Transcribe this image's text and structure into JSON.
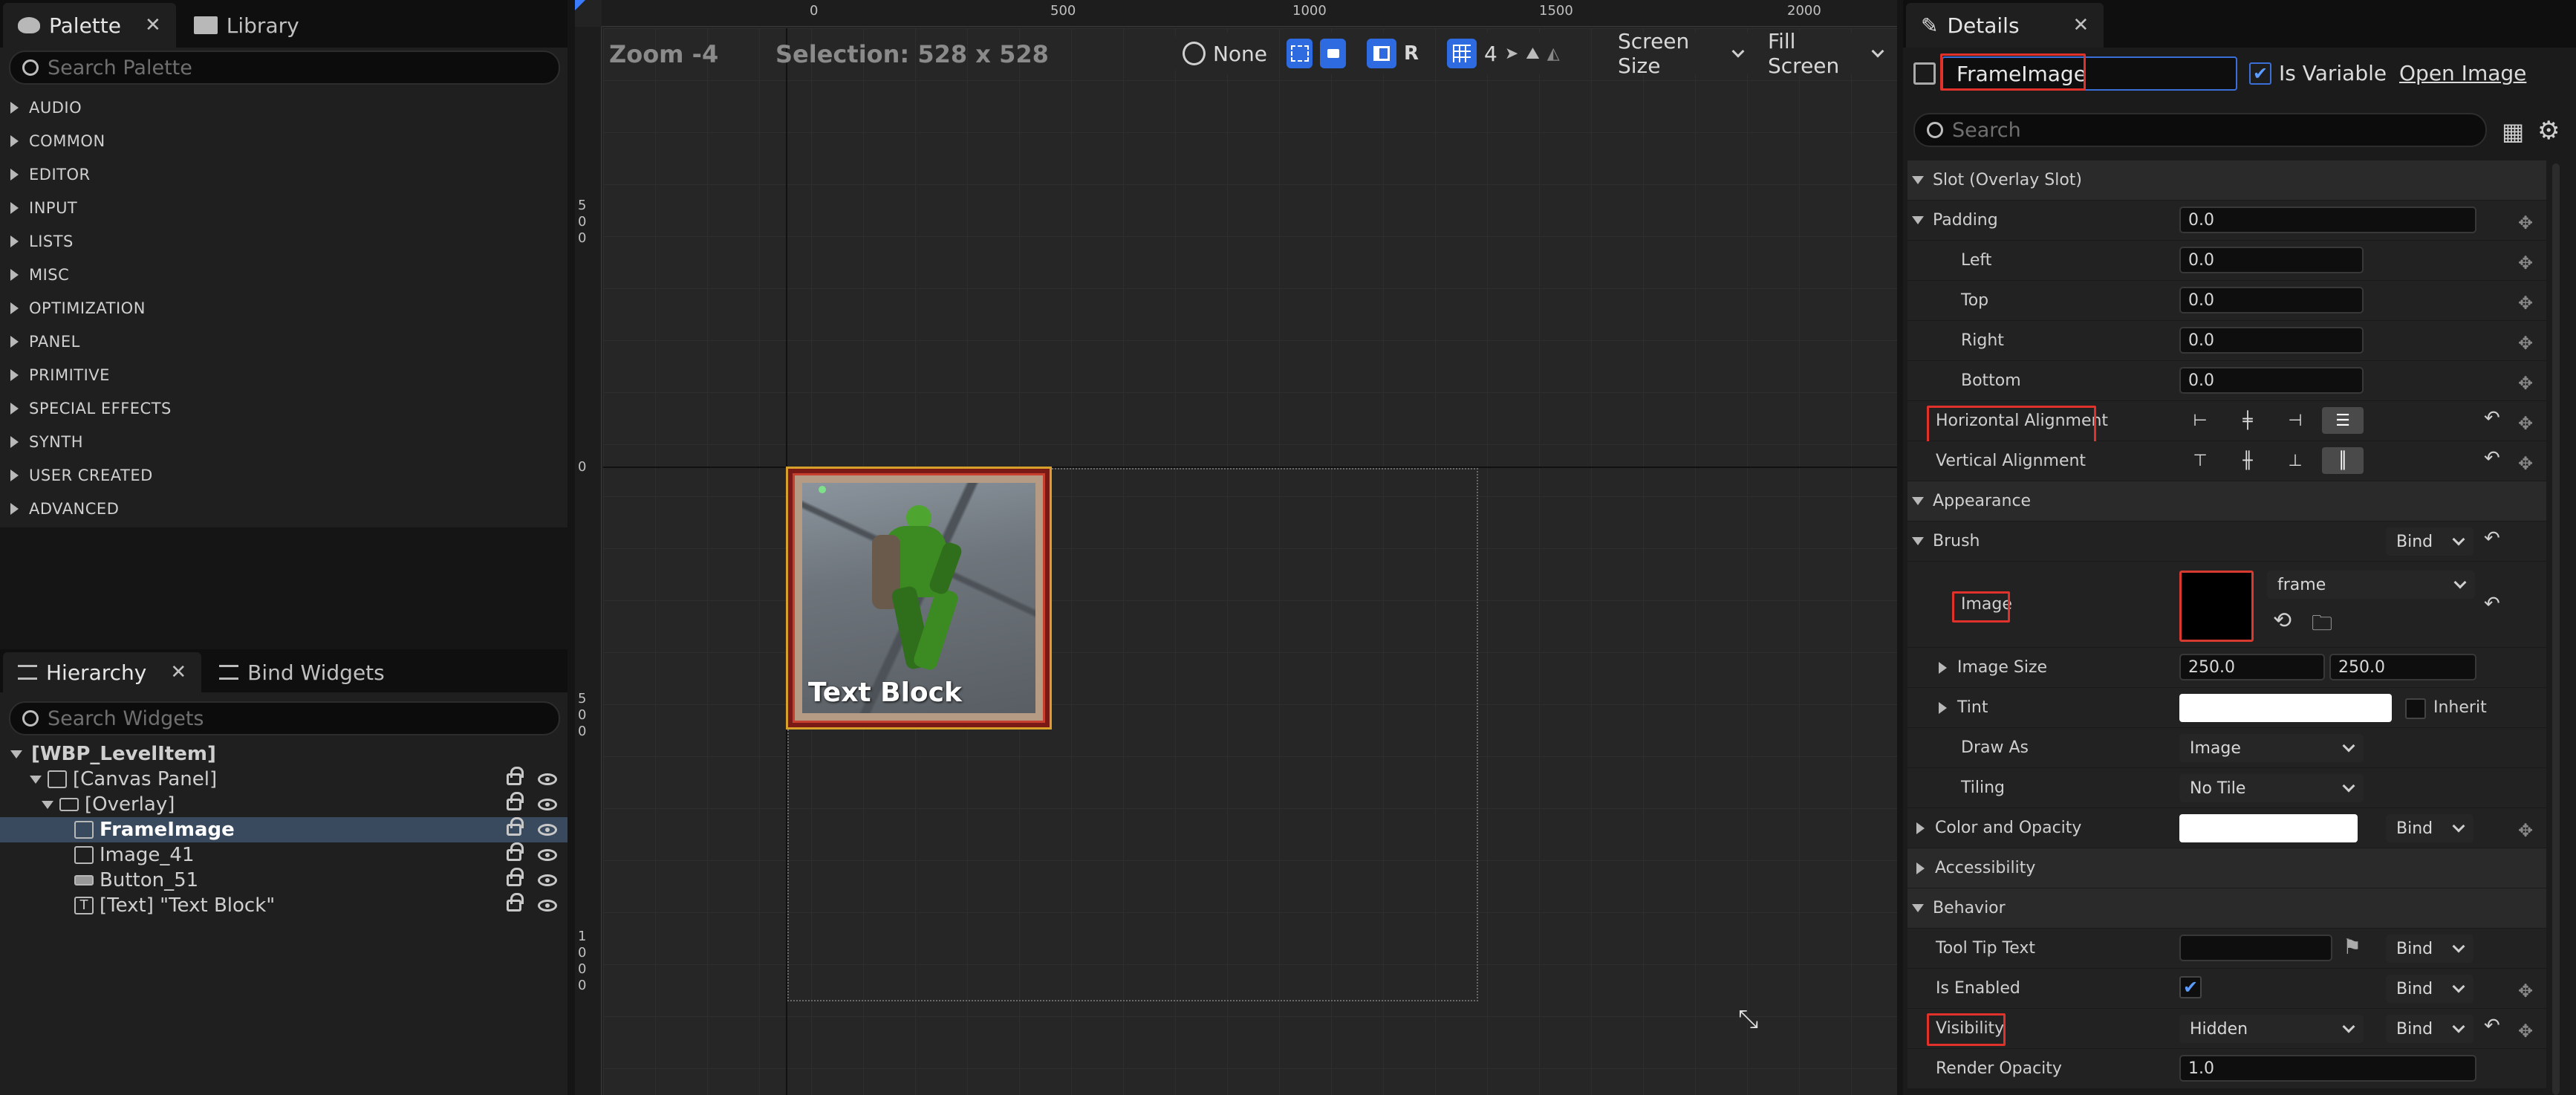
{
  "palette": {
    "tabs": [
      {
        "label": "Palette"
      },
      {
        "label": "Library"
      }
    ],
    "search_placeholder": "Search Palette",
    "categories": [
      {
        "label": "AUDIO"
      },
      {
        "label": "COMMON"
      },
      {
        "label": "EDITOR"
      },
      {
        "label": "INPUT"
      },
      {
        "label": "LISTS"
      },
      {
        "label": "MISC"
      },
      {
        "label": "OPTIMIZATION"
      },
      {
        "label": "PANEL"
      },
      {
        "label": "PRIMITIVE"
      },
      {
        "label": "SPECIAL EFFECTS"
      },
      {
        "label": "SYNTH"
      },
      {
        "label": "USER CREATED"
      },
      {
        "label": "ADVANCED"
      }
    ]
  },
  "hierarchy": {
    "tabs": [
      {
        "label": "Hierarchy"
      },
      {
        "label": "Bind Widgets"
      }
    ],
    "search_placeholder": "Search Widgets",
    "root": "[WBP_LevelItem]",
    "items": [
      {
        "label": "[Canvas Panel]"
      },
      {
        "label": "[Overlay]"
      },
      {
        "label": "FrameImage"
      },
      {
        "label": "Image_41"
      },
      {
        "label": "Button_51"
      },
      {
        "label": "[Text] \"Text Block\""
      }
    ]
  },
  "canvas": {
    "zoom": "Zoom -4",
    "selection": "Selection: 528 x 528",
    "ruler_top": [
      "0",
      "500",
      "1000",
      "1500",
      "2000"
    ],
    "ruler_left": [
      "500",
      "0",
      "500",
      "1000"
    ],
    "toolbar": {
      "localization": "None",
      "r_label": "R",
      "grid_value": "4",
      "screen_size": "Screen Size",
      "fill_screen": "Fill Screen"
    },
    "widget_text": "Text Block"
  },
  "details": {
    "tab": "Details",
    "name_value": "FrameImage",
    "is_variable_label": "Is Variable",
    "open_image": "Open Image",
    "search_placeholder": "Search",
    "slot_section": "Slot (Overlay Slot)",
    "padding_label": "Padding",
    "padding_value": "0.0",
    "left_label": "Left",
    "left_value": "0.0",
    "top_label": "Top",
    "top_value": "0.0",
    "right_label": "Right",
    "right_value": "0.0",
    "bottom_label": "Bottom",
    "bottom_value": "0.0",
    "h_align_label": "Horizontal Alignment",
    "v_align_label": "Vertical Alignment",
    "appearance_section": "Appearance",
    "brush_label": "Brush",
    "bind_label": "Bind",
    "image_label": "Image",
    "image_asset": "frame",
    "image_size_label": "Image Size",
    "image_size_x": "250.0",
    "image_size_y": "250.0",
    "tint_label": "Tint",
    "inherit_label": "Inherit",
    "draw_as_label": "Draw As",
    "draw_as_value": "Image",
    "tiling_label": "Tiling",
    "tiling_value": "No Tile",
    "color_opacity_label": "Color and Opacity",
    "accessibility_section": "Accessibility",
    "behavior_section": "Behavior",
    "tooltip_label": "Tool Tip Text",
    "is_enabled_label": "Is Enabled",
    "visibility_label": "Visibility",
    "visibility_value": "Hidden",
    "render_opacity_label": "Render Opacity",
    "render_opacity_value": "1.0"
  }
}
